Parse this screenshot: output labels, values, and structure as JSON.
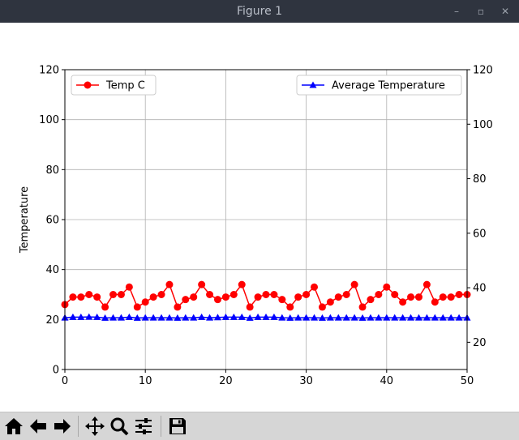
{
  "window": {
    "title": "Figure 1",
    "minimize_glyph": "–",
    "restore_glyph": "▫",
    "close_glyph": "✕"
  },
  "toolbar": {
    "items": [
      {
        "name": "home-icon"
      },
      {
        "name": "back-icon"
      },
      {
        "name": "forward-icon"
      },
      {
        "name": "pan-icon"
      },
      {
        "name": "zoom-icon"
      },
      {
        "name": "subplots-icon"
      },
      {
        "name": "save-icon"
      }
    ]
  },
  "chart_data": {
    "type": "line",
    "title": "",
    "xlabel": "",
    "ylabel": "Temperature",
    "xlim": [
      0,
      50
    ],
    "ylim": [
      0,
      120
    ],
    "y2lim": [
      10,
      120
    ],
    "x_ticks": [
      "0",
      "10",
      "20",
      "30",
      "40",
      "50"
    ],
    "y_ticks": [
      "0",
      "20",
      "40",
      "60",
      "80",
      "100",
      "120"
    ],
    "y2_ticks": [
      "20",
      "40",
      "60",
      "80",
      "100",
      "120"
    ],
    "grid": true,
    "series": [
      {
        "name": "Temp C",
        "axis": "left",
        "color": "#ff0000",
        "marker": "circle",
        "legend_position": "upper-left",
        "x": [
          0,
          1,
          2,
          3,
          4,
          5,
          6,
          7,
          8,
          9,
          10,
          11,
          12,
          13,
          14,
          15,
          16,
          17,
          18,
          19,
          20,
          21,
          22,
          23,
          24,
          25,
          26,
          27,
          28,
          29,
          30,
          31,
          32,
          33,
          34,
          35,
          36,
          37,
          38,
          39,
          40,
          41,
          42,
          43,
          44,
          45,
          46,
          47,
          48,
          49,
          50
        ],
        "values": [
          26,
          29,
          29,
          30,
          29,
          25,
          30,
          30,
          33,
          25,
          27,
          29,
          30,
          34,
          25,
          28,
          29,
          34,
          30,
          28,
          29,
          30,
          34,
          25,
          29,
          30,
          30,
          28,
          25,
          29,
          30,
          33,
          25,
          27,
          29,
          30,
          34,
          25,
          28,
          30,
          33,
          30,
          27,
          29,
          29,
          34,
          27,
          29,
          29,
          30,
          30
        ]
      },
      {
        "name": "Average Temperature",
        "axis": "right",
        "color": "#0000ff",
        "marker": "triangle",
        "legend_position": "upper-right",
        "x": [
          0,
          1,
          2,
          3,
          4,
          5,
          6,
          7,
          8,
          9,
          10,
          11,
          12,
          13,
          14,
          15,
          16,
          17,
          18,
          19,
          20,
          21,
          22,
          23,
          24,
          25,
          26,
          27,
          28,
          29,
          30,
          31,
          32,
          33,
          34,
          35,
          36,
          37,
          38,
          39,
          40,
          41,
          42,
          43,
          44,
          45,
          46,
          47,
          48,
          49,
          50
        ],
        "values": [
          29,
          29.2,
          29.2,
          29.3,
          29.2,
          28.9,
          29,
          29,
          29.2,
          28.9,
          29,
          29,
          29,
          29,
          28.9,
          29,
          29,
          29.2,
          29,
          29.1,
          29.2,
          29.2,
          29.2,
          28.9,
          29.2,
          29.2,
          29.2,
          29,
          28.9,
          29,
          29,
          29,
          28.9,
          29,
          29,
          29,
          29,
          28.9,
          29,
          29,
          29,
          29,
          29,
          29,
          29,
          29,
          29,
          29,
          29,
          29,
          29
        ]
      }
    ]
  }
}
